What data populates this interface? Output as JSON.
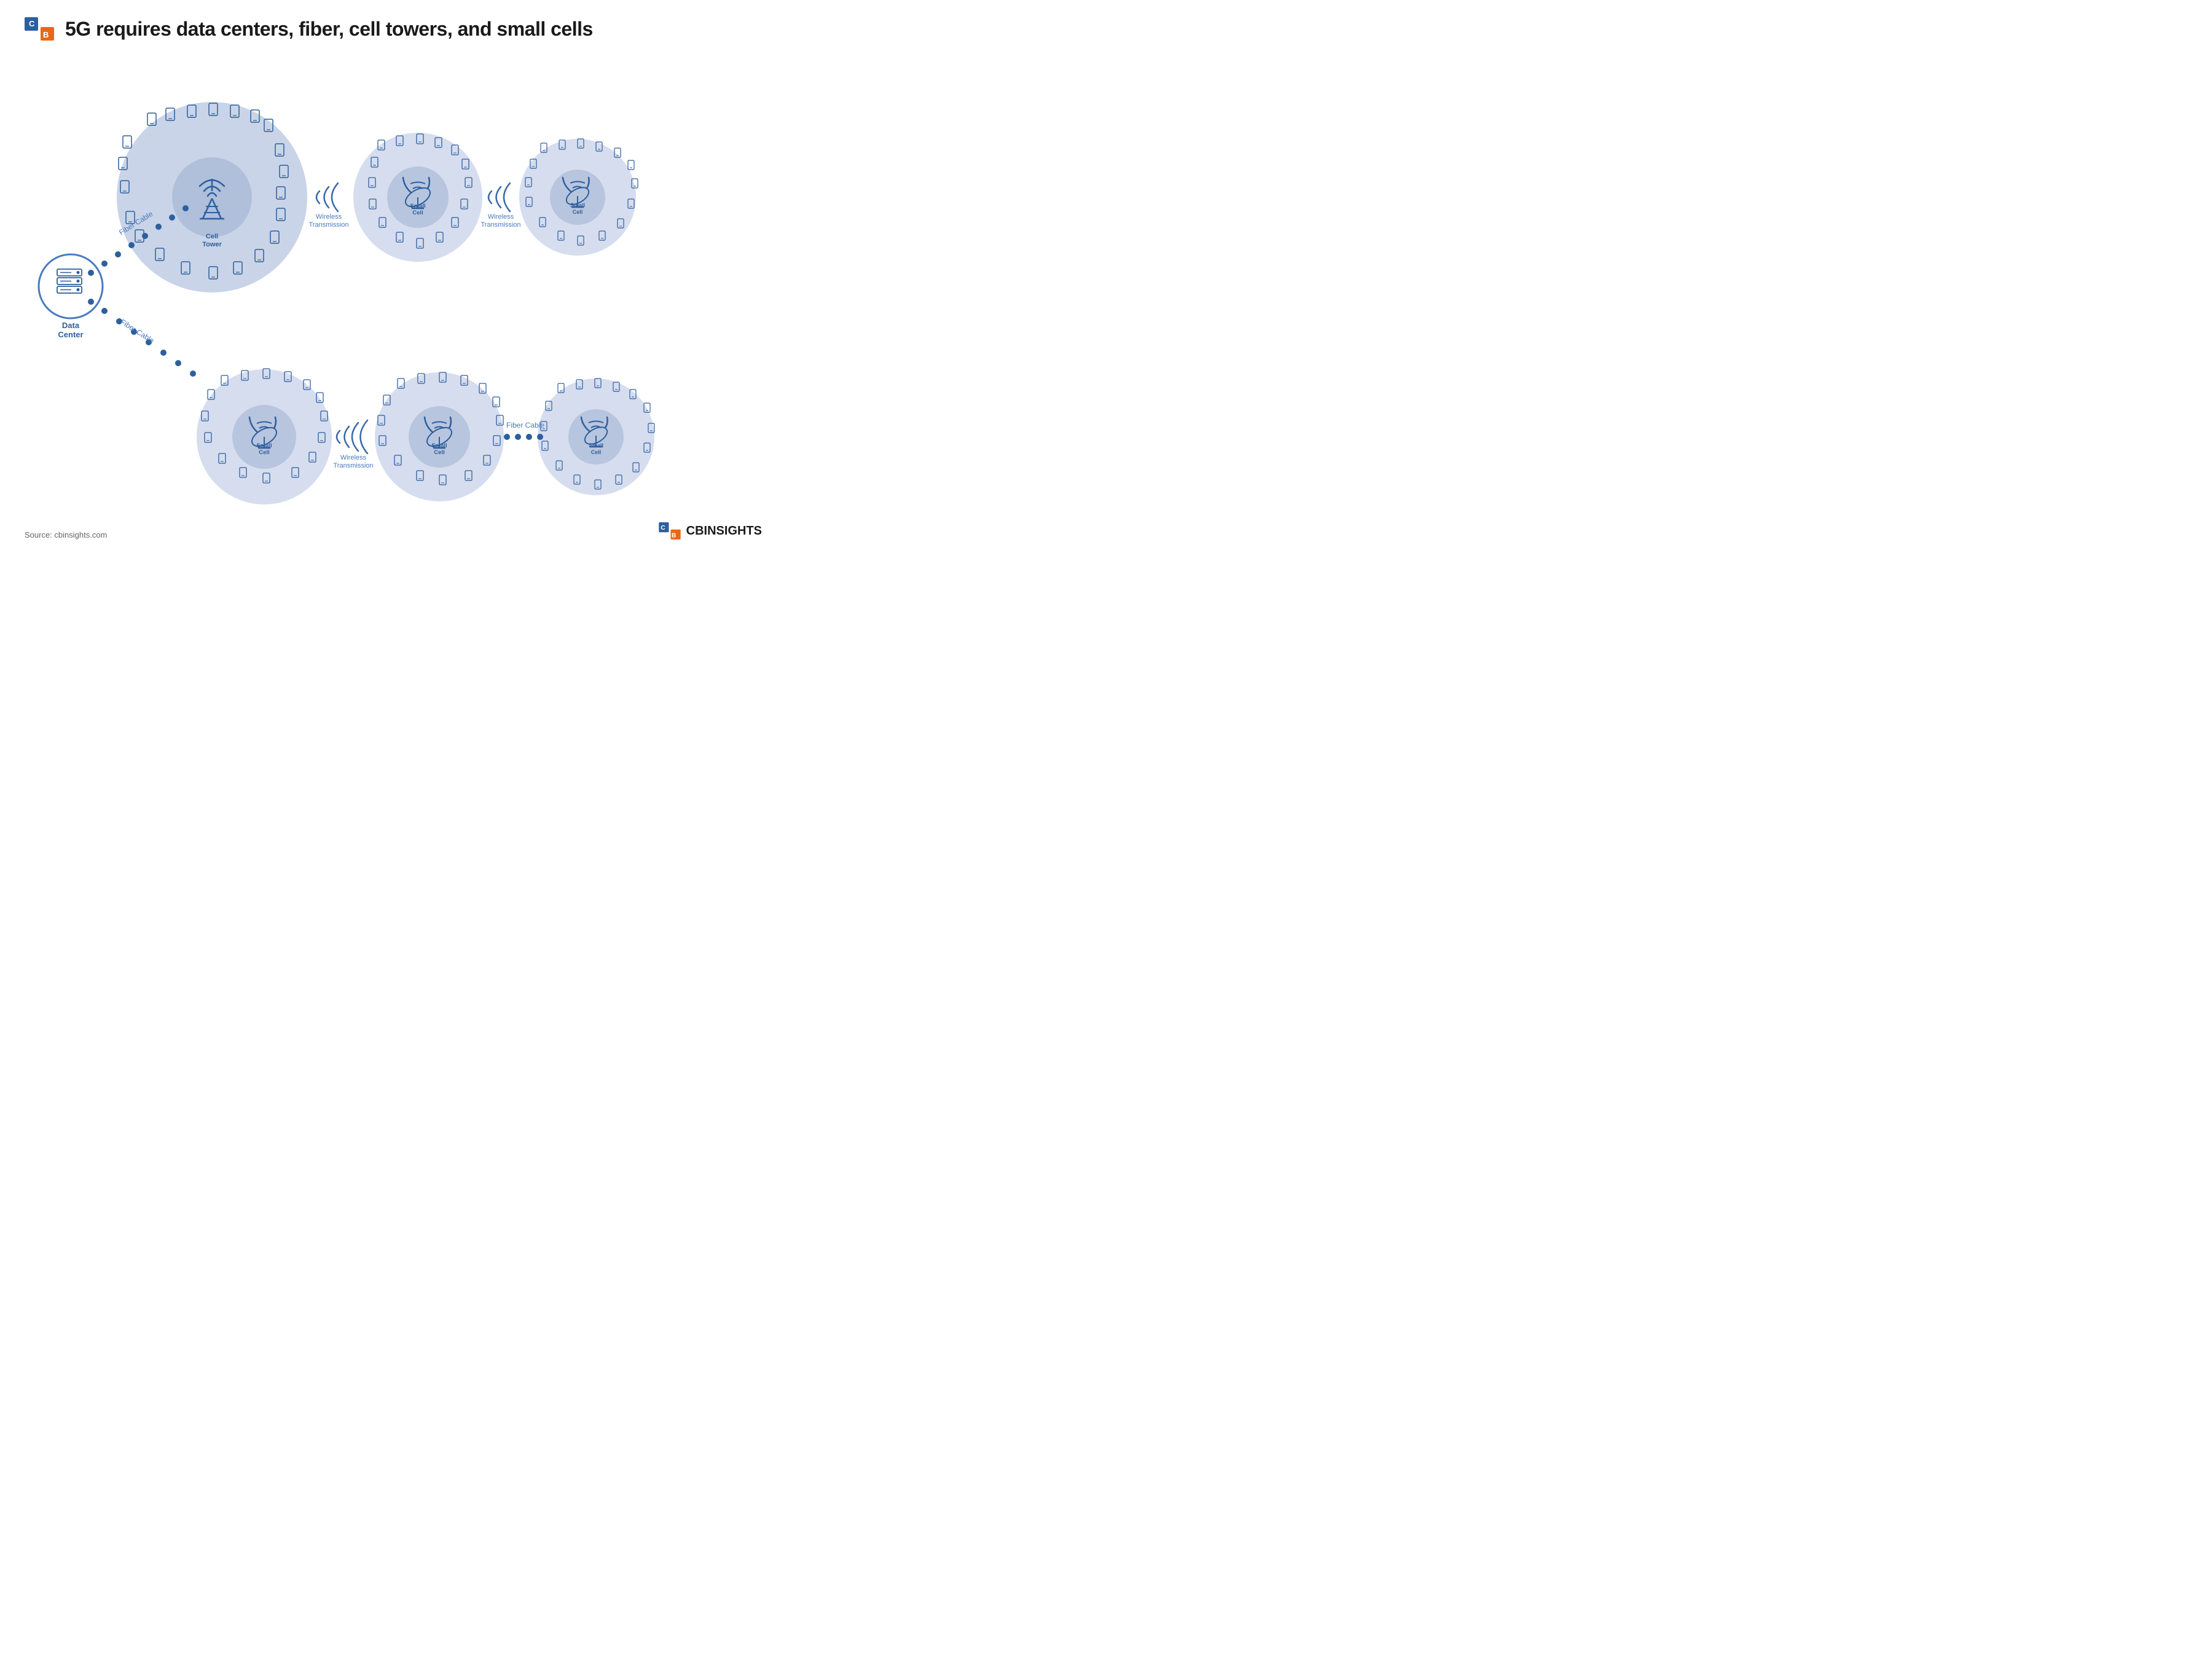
{
  "header": {
    "title": "5G requires data centers, fiber, cell towers, and small cells"
  },
  "nodes": {
    "data_center": {
      "label": "Data\nCenter"
    },
    "cell_tower": {
      "label": "Cell\nTower"
    },
    "small_cell": {
      "label": "Small\nCell"
    }
  },
  "connections": {
    "fiber_cable_1": "Fiber Cable",
    "fiber_cable_2": "Fiber Cable",
    "fiber_cable_3": "Fiber Cable",
    "wireless_1": "Wireless\nTransmission",
    "wireless_2": "Wireless\nTransmission",
    "wireless_3": "Wireless\nTransmission"
  },
  "footer": {
    "source": "Source: cbinsights.com",
    "brand": "CBINSIGHTS"
  },
  "colors": {
    "blue_dark": "#2c5f9e",
    "blue_mid": "#4a7abf",
    "blue_light": "#c9d4e8",
    "blue_lighter": "#d6ddef",
    "orange": "#e8671a"
  }
}
